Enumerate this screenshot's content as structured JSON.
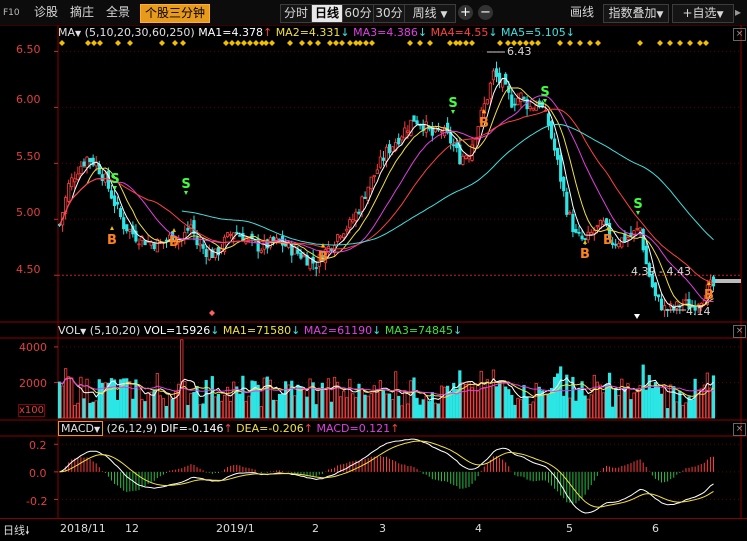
{
  "toolbar": {
    "f10": "F10",
    "diagnose": "诊股",
    "sort": "摘庄",
    "fullview": "全景",
    "three_min": "个股三分钟",
    "periods": [
      "分时",
      "日线",
      "60分",
      "30分",
      "周线"
    ],
    "active_period": "日线",
    "plus": "+",
    "minus": "−",
    "draw": "画线",
    "overlay_index": "指数叠加",
    "watchlist": "+自选"
  },
  "main_chart": {
    "legend_name": "MA",
    "params": "(5,10,20,30,60,250)",
    "ma1": "MA1=4.378",
    "ma2": "MA2=4.331",
    "ma3": "MA3=4.386",
    "ma4": "MA4=4.55",
    "ma5": "MA5=5.105",
    "y_ticks": [
      "6.50",
      "6.00",
      "5.50",
      "5.00",
      "4.50"
    ],
    "high_label": "6.43",
    "low_label": "4.14",
    "range_label": "4.39 - 4.43"
  },
  "vol_chart": {
    "legend_name": "VOL",
    "params": "(5,10,20)",
    "vol": "VOL=15926",
    "ma1": "MA1=71580",
    "ma2": "MA2=61190",
    "ma3": "MA3=74845",
    "y_ticks": [
      "4000",
      "2000"
    ],
    "unit": "x100"
  },
  "macd_chart": {
    "legend_name": "MACD",
    "params": "(26,12,9)",
    "dif": "DIF=-0.146",
    "dea": "DEA=-0.206",
    "macd": "MACD=0.121",
    "y_ticks": [
      "0.2",
      "0.0",
      "-0.2"
    ]
  },
  "date_axis": {
    "period_label": "日线",
    "labels": [
      "2018/11",
      "12",
      "2019/1",
      "2",
      "3",
      "4",
      "5",
      "6"
    ]
  },
  "signals": {
    "buy": "B",
    "sell": "S"
  },
  "colors": {
    "up": "#ff3c3c",
    "down": "#2ce6e6",
    "ma1": "#ffffff",
    "ma2": "#f0e040",
    "ma3": "#e040e0",
    "ma4": "#ff4040",
    "ma5": "#40e0e0"
  },
  "chart_data": {
    "type": "candlestick",
    "y_range": [
      4.1,
      6.62
    ],
    "axis_months": [
      "2018/11",
      "12",
      "2019/1",
      "2",
      "3",
      "4",
      "5",
      "6"
    ],
    "close_path": [
      [
        0,
        4.95
      ],
      [
        3,
        5.3
      ],
      [
        6,
        5.45
      ],
      [
        9,
        5.55
      ],
      [
        12,
        5.5
      ],
      [
        15,
        5.35
      ],
      [
        18,
        5.15
      ],
      [
        21,
        4.95
      ],
      [
        25,
        4.85
      ],
      [
        29,
        4.8
      ],
      [
        33,
        4.78
      ],
      [
        37,
        4.85
      ],
      [
        40,
        4.82
      ],
      [
        43,
        4.95
      ],
      [
        45,
        4.78
      ],
      [
        48,
        4.72
      ],
      [
        51,
        4.68
      ],
      [
        54,
        4.8
      ],
      [
        57,
        4.9
      ],
      [
        60,
        4.85
      ],
      [
        63,
        4.78
      ],
      [
        66,
        4.75
      ],
      [
        69,
        4.78
      ],
      [
        72,
        4.8
      ],
      [
        75,
        4.75
      ],
      [
        78,
        4.7
      ],
      [
        81,
        4.65
      ],
      [
        84,
        4.6
      ],
      [
        86,
        4.68
      ],
      [
        89,
        4.78
      ],
      [
        92,
        4.9
      ],
      [
        95,
        4.95
      ],
      [
        98,
        5.1
      ],
      [
        101,
        5.3
      ],
      [
        104,
        5.45
      ],
      [
        107,
        5.6
      ],
      [
        110,
        5.7
      ],
      [
        113,
        5.8
      ],
      [
        116,
        5.9
      ],
      [
        119,
        5.85
      ],
      [
        122,
        5.75
      ],
      [
        125,
        5.8
      ],
      [
        128,
        5.7
      ],
      [
        131,
        5.55
      ],
      [
        134,
        5.6
      ],
      [
        137,
        5.85
      ],
      [
        140,
        6.1
      ],
      [
        142,
        6.3
      ],
      [
        145,
        6.2
      ],
      [
        148,
        6.05
      ],
      [
        151,
        6.1
      ],
      [
        154,
        6.0
      ],
      [
        157,
        6.05
      ],
      [
        160,
        5.85
      ],
      [
        163,
        5.5
      ],
      [
        166,
        5.1
      ],
      [
        169,
        4.85
      ],
      [
        172,
        4.8
      ],
      [
        175,
        4.9
      ],
      [
        178,
        4.95
      ],
      [
        181,
        4.8
      ],
      [
        184,
        4.82
      ],
      [
        187,
        4.85
      ],
      [
        190,
        4.92
      ],
      [
        192,
        4.6
      ],
      [
        195,
        4.3
      ],
      [
        198,
        4.2
      ],
      [
        201,
        4.2
      ],
      [
        204,
        4.25
      ],
      [
        207,
        4.22
      ],
      [
        210,
        4.3
      ],
      [
        213,
        4.4
      ]
    ],
    "ma_labels": [
      "MA1=4.378",
      "MA2=4.331",
      "MA3=4.386",
      "MA4=4.55",
      "MA5=5.105"
    ],
    "volume_range": [
      0,
      4500
    ],
    "macd_range": [
      -0.32,
      0.26
    ]
  }
}
